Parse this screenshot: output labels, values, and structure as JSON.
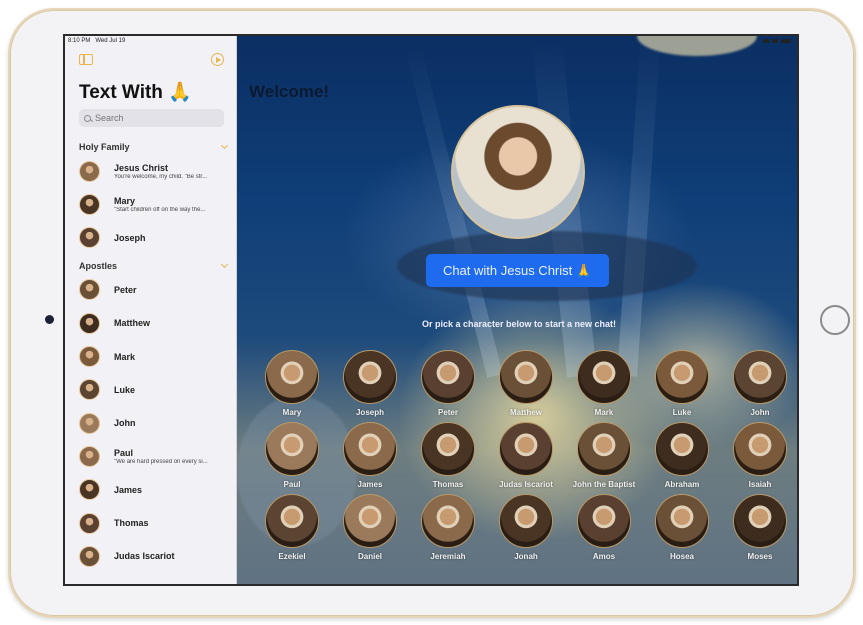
{
  "status_bar": {
    "time": "8:10 PM",
    "date": "Wed Jul 19"
  },
  "sidebar": {
    "title": "Text With 🙏",
    "toggle_icon": "sidebar-toggle-icon",
    "play_icon": "play-circle-icon",
    "search": {
      "placeholder": "Search",
      "value": ""
    },
    "sections": [
      {
        "title": "Holy Family",
        "contacts": [
          {
            "name": "Jesus Christ",
            "preview": "You're welcome, my child. \"Be str..."
          },
          {
            "name": "Mary",
            "preview": "\"Start children off on the way the..."
          },
          {
            "name": "Joseph",
            "preview": ""
          }
        ]
      },
      {
        "title": "Apostles",
        "contacts": [
          {
            "name": "Peter",
            "preview": ""
          },
          {
            "name": "Matthew",
            "preview": ""
          },
          {
            "name": "Mark",
            "preview": ""
          },
          {
            "name": "Luke",
            "preview": ""
          },
          {
            "name": "John",
            "preview": ""
          },
          {
            "name": "Paul",
            "preview": "\"We are hard pressed on every si..."
          },
          {
            "name": "James",
            "preview": ""
          },
          {
            "name": "Thomas",
            "preview": ""
          },
          {
            "name": "Judas Iscariot",
            "preview": ""
          }
        ]
      }
    ]
  },
  "main": {
    "heading": "Welcome!",
    "featured_character": "Jesus Christ",
    "chat_button_label": "Chat with Jesus Christ 🙏",
    "subtitle": "Or pick a character below to start a new chat!",
    "characters": [
      "Mary",
      "Joseph",
      "Peter",
      "Matthew",
      "Mark",
      "Luke",
      "John",
      "Paul",
      "James",
      "Thomas",
      "Judas Iscariot",
      "John the Baptist",
      "Abraham",
      "Isaiah",
      "Ezekiel",
      "Daniel",
      "Jeremiah",
      "Jonah",
      "Amos",
      "Hosea",
      "Moses"
    ]
  },
  "colors": {
    "accent": "#e9b54e",
    "button": "#1f6bf0",
    "sidebar_bg": "#f1f1f6"
  }
}
